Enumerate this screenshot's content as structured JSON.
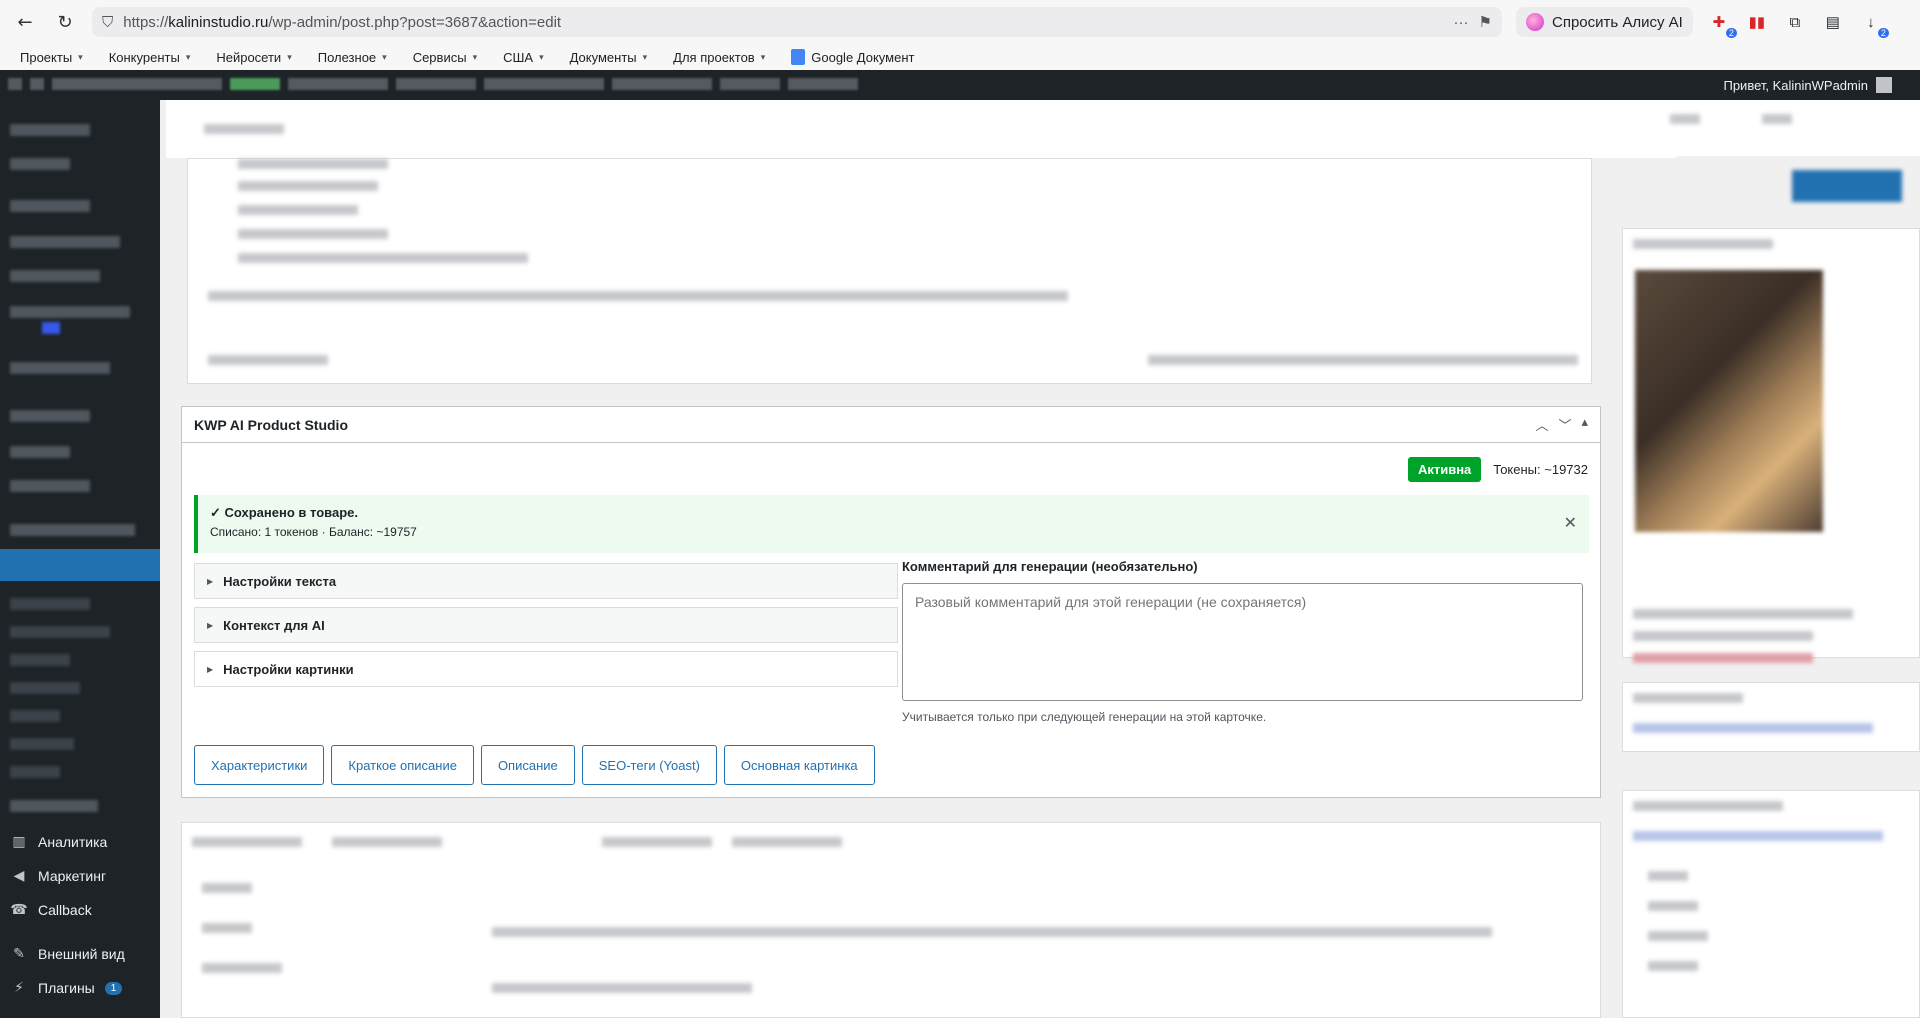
{
  "browser": {
    "url_scheme": "https://",
    "url_host": "kalininstudio.ru",
    "url_path": "/wp-admin/post.php?post=3687&action=edit",
    "alice_label": "Спросить Алису AI",
    "bookmarks": [
      "Проекты",
      "Конкуренты",
      "Нейросети",
      "Полезное",
      "Сервисы",
      "США",
      "Документы",
      "Для проектов",
      "Google Документ"
    ],
    "ext_badges": [
      "2",
      "2"
    ]
  },
  "adminbar": {
    "greeting": "Привет, KalininWPadmin"
  },
  "sidebar": {
    "items": [
      {
        "label": "Аналитика",
        "icon": "analytics-icon"
      },
      {
        "label": "Маркетинг",
        "icon": "megaphone-icon"
      },
      {
        "label": "Callback",
        "icon": "phone-icon"
      },
      {
        "label": "Внешний вид",
        "icon": "paintbrush-icon"
      },
      {
        "label": "Плагины",
        "icon": "plugin-icon",
        "badge": "1"
      }
    ]
  },
  "kwp": {
    "title": "KWP AI Product Studio",
    "status": "Активна",
    "tokens": "Токены: ~19732",
    "notice_title": "✓ Сохранено в товаре.",
    "notice_sub": "Списано: 1 токенов · Баланс: ~19757",
    "accordions": [
      "Настройки текста",
      "Контекст для AI",
      "Настройки картинки"
    ],
    "comment_label": "Комментарий для генерации (необязательно)",
    "comment_placeholder": "Разовый комментарий для этой генерации (не сохраняется)",
    "comment_hint": "Учитывается только при следующей генерации на этой карточке.",
    "buttons": [
      "Характеристики",
      "Краткое описание",
      "Описание",
      "SEO-теги (Yoast)",
      "Основная картинка"
    ]
  }
}
